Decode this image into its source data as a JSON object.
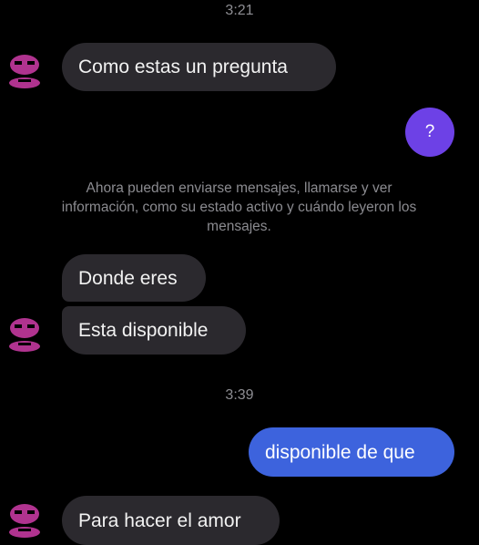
{
  "conversation": {
    "time_1": "3:21",
    "time_2": "3:39",
    "messages": {
      "m1": "Como estas un pregunta",
      "m2": "?",
      "m3": "Donde eres",
      "m4": "Esta disponible",
      "m5": "disponible de que",
      "m6": "Para hacer el amor"
    },
    "notice": "Ahora pueden enviarse mensajes, llamarse y ver información, como su estado activo y cuándo leyeron los mensajes."
  },
  "colors": {
    "background": "#000000",
    "incoming_bubble": "#2b292e",
    "outgoing_bubble": "#3d63dd",
    "reaction_circle": "#6d41e6",
    "avatar": "#b0338f",
    "meta_text": "#8e8e93"
  },
  "icons": {
    "avatar": "contact-avatar-icon"
  }
}
